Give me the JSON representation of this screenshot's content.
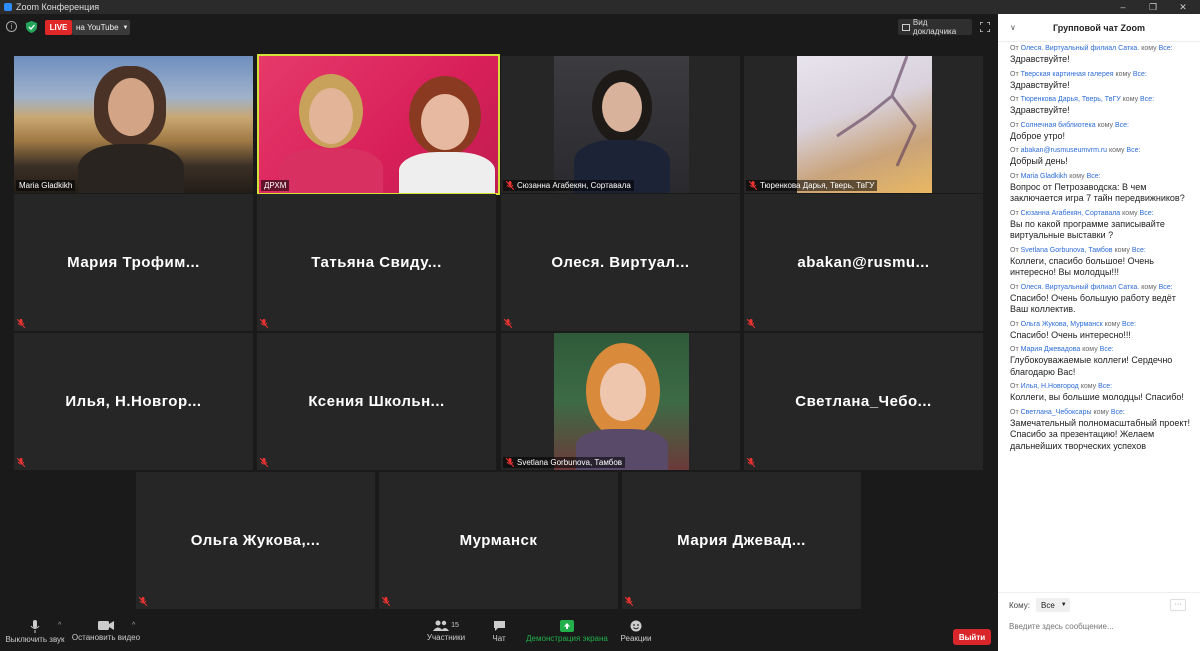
{
  "window": {
    "title": "Zoom Конференция"
  },
  "topbar": {
    "live_label": "LIVE",
    "stream_target": "на YouTube",
    "view_label": "Вид докладчика"
  },
  "tiles": {
    "maria_gladkikh": "Maria Gladkikh",
    "drhm": "ДРХМ",
    "syuzanna": "Сюзанна Агабекян, Сортавала",
    "tyurenkova": "Тюренкова Дарья, Тверь, ТвГУ",
    "maria_trof": "Мария  Трофим...",
    "tatyana": "Татьяна  Свиду...",
    "olesya": "Олеся.  Виртуал...",
    "abakan": "abakan@rusmu...",
    "ilya": "Илья,  Н.Новгор...",
    "kseniya": "Ксения  Школьн...",
    "svetlana_g": "Svetlana Gorbunova, Тамбов",
    "svetlana_ch": "Светлана_Чебо...",
    "olga": "Ольга  Жукова,...",
    "murmansk": "Мурманск",
    "maria_dzh": "Мария  Джевад..."
  },
  "toolbar": {
    "mute": "Выключить звук",
    "video": "Остановить видео",
    "participants": "Участники",
    "participants_count": "15",
    "chat": "Чат",
    "share": "Демонстрация экрана",
    "reactions": "Реакции",
    "leave": "Выйти"
  },
  "chat": {
    "title": "Групповой чат Zoom",
    "from_prefix": "От",
    "to_word": "кому",
    "messages": [
      {
        "from": "Олеся. Виртуальный филиал Сатка.",
        "to": "Все:",
        "text": "Здравствуйте!"
      },
      {
        "from": "Тверская картинная галерея",
        "to": "Все:",
        "text": "Здравствуйте!"
      },
      {
        "from": "Тюренкова Дарья, Тверь, ТвГУ",
        "to": "Все:",
        "text": "Здравствуйте!"
      },
      {
        "from": "Солнечная библиотека",
        "to": "Все:",
        "text": "Доброе утро!"
      },
      {
        "from": "abakan@rusmuseumvrm.ru",
        "to": "Все:",
        "text": "Добрый день!"
      },
      {
        "from": "Maria Gladkikh",
        "to": "Все:",
        "text": "Вопрос от Петрозаводска: В чем заключается игра 7 тайн передвижников?"
      },
      {
        "from": "Сюзанна Агабекян, Сортавала",
        "to": "Все:",
        "text": "Вы по какой программе записывайте виртуальные выставки ?"
      },
      {
        "from": "Svetlana Gorbunova, Тамбов",
        "to": "Все:",
        "text": "Коллеги, спасибо большое! Очень интересно! Вы молодцы!!!"
      },
      {
        "from": "Олеся. Виртуальный филиал Сатка.",
        "to": "Все:",
        "text": "Спасибо! Очень большую работу ведёт Ваш коллектив."
      },
      {
        "from": "Ольга Жукова, Мурманск",
        "to": "Все:",
        "text": "Спасибо! Очень интересно!!!"
      },
      {
        "from": "Мария Джевадова",
        "to": "Все:",
        "text": "Глубокоуважаемые коллеги! Сердечно благодарю Вас!"
      },
      {
        "from": "Илья, Н.Новгород",
        "to": "Все:",
        "text": "Коллеги, вы большие молодцы! Спасибо!"
      },
      {
        "from": "Светлана_Чебоксары",
        "to": "Все:",
        "text": "Замечательный полномасштабный проект! Спасибо за презентацию! Желаем дальнейших творческих успехов"
      }
    ],
    "to_label": "Кому:",
    "to_value": "Все",
    "input_placeholder": "Введите здесь сообщение..."
  },
  "colors": {
    "accent_blue": "#2d6cd8",
    "live_red": "#e02828",
    "active_speaker": "#d4e03a",
    "share_green": "#21b04b",
    "leave_red": "#d9262b"
  }
}
